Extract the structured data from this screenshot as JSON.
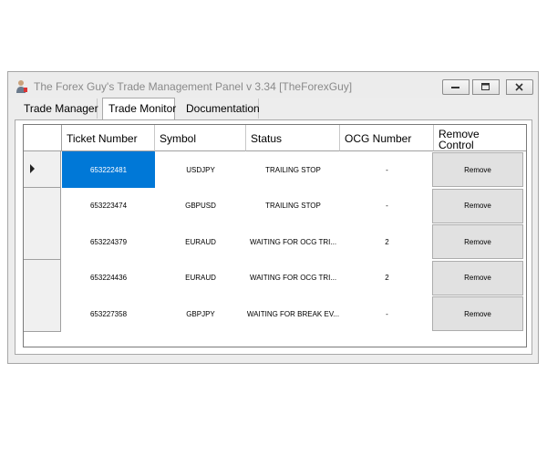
{
  "window": {
    "title": "The Forex Guy's Trade Management Panel v 3.34 [TheForexGuy]"
  },
  "tabs": [
    {
      "label": "Trade Manager",
      "active": false
    },
    {
      "label": "Trade Monitor",
      "active": true
    },
    {
      "label": "Documentation",
      "active": false
    }
  ],
  "grid": {
    "columns": [
      "Ticket Number",
      "Symbol",
      "Status",
      "OCG Number",
      "Remove Control"
    ],
    "rows": [
      {
        "ticket": "653222481",
        "symbol": "USDJPY",
        "status": "TRAILING STOP",
        "ocg": "-",
        "remove": "Remove",
        "current": true
      },
      {
        "ticket": "653223474",
        "symbol": "GBPUSD",
        "status": "TRAILING STOP",
        "ocg": "-",
        "remove": "Remove",
        "current": false
      },
      {
        "ticket": "653224379",
        "symbol": "EURAUD",
        "status": "WAITING FOR OCG TRI...",
        "ocg": "2",
        "remove": "Remove",
        "current": false
      },
      {
        "ticket": "653224436",
        "symbol": "EURAUD",
        "status": "WAITING FOR OCG TRI...",
        "ocg": "2",
        "remove": "Remove",
        "current": false
      },
      {
        "ticket": "653227358",
        "symbol": "GBPJPY",
        "status": "WAITING FOR BREAK EV...",
        "ocg": "-",
        "remove": "Remove",
        "current": false
      }
    ]
  },
  "icons": {
    "app": "user-icon",
    "minimize": "minimize-icon",
    "maximize": "maximize-icon",
    "close": "close-icon",
    "current_row": "row-pointer-icon"
  },
  "colors": {
    "selection": "#0078d7",
    "window_bg": "#ededed"
  }
}
